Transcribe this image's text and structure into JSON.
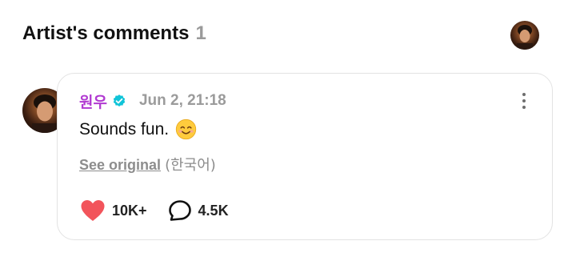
{
  "header": {
    "title": "Artist's comments",
    "count": "1",
    "avatar_icon": "user-avatar"
  },
  "comment": {
    "author": "원우",
    "verified_icon": "verified-badge-icon",
    "timestamp": "Jun 2, 21:18",
    "text": "Sounds fun.",
    "emoji_icon": "smiling-face-icon",
    "see_original_label": "See original",
    "language_label": "(한국어)",
    "likes": "10K+",
    "replies": "4.5K",
    "more_icon": "more-vertical-icon",
    "like_icon": "heart-icon",
    "reply_icon": "comment-bubble-icon"
  },
  "colors": {
    "author": "#b13ad1",
    "verified": "#10c4d8",
    "heart": "#f2545b",
    "muted": "#9b9b9b"
  }
}
